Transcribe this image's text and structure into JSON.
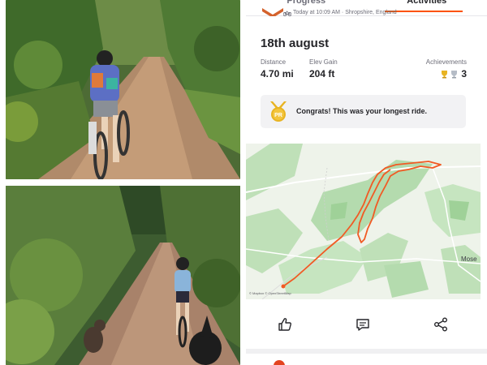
{
  "tabs": [
    {
      "label": "Progress",
      "active": false
    },
    {
      "label": "Activities",
      "active": true
    }
  ],
  "activity": {
    "meta": "Today at 10:09 AM · Shropshire, England",
    "title": "18th august",
    "stats": {
      "distance_label": "Distance",
      "distance_value": "4.70 mi",
      "elev_label": "Elev Gain",
      "elev_value": "204 ft",
      "achievements_label": "Achievements",
      "achievements_count": "3"
    },
    "congrats": {
      "badge": "PR",
      "text": "Congrats! This was your longest ride."
    }
  },
  "map": {
    "place_label": "Mose",
    "credit": "© Mapbox © OpenStreetMap"
  },
  "actions": {
    "like_icon": "thumbs-up-icon",
    "comment_icon": "comment-icon",
    "share_icon": "share-icon"
  },
  "colors": {
    "brand": "#fc5200",
    "route": "#f15a24",
    "map_green": "#b9dcb5",
    "map_bg": "#eaf2e6"
  }
}
